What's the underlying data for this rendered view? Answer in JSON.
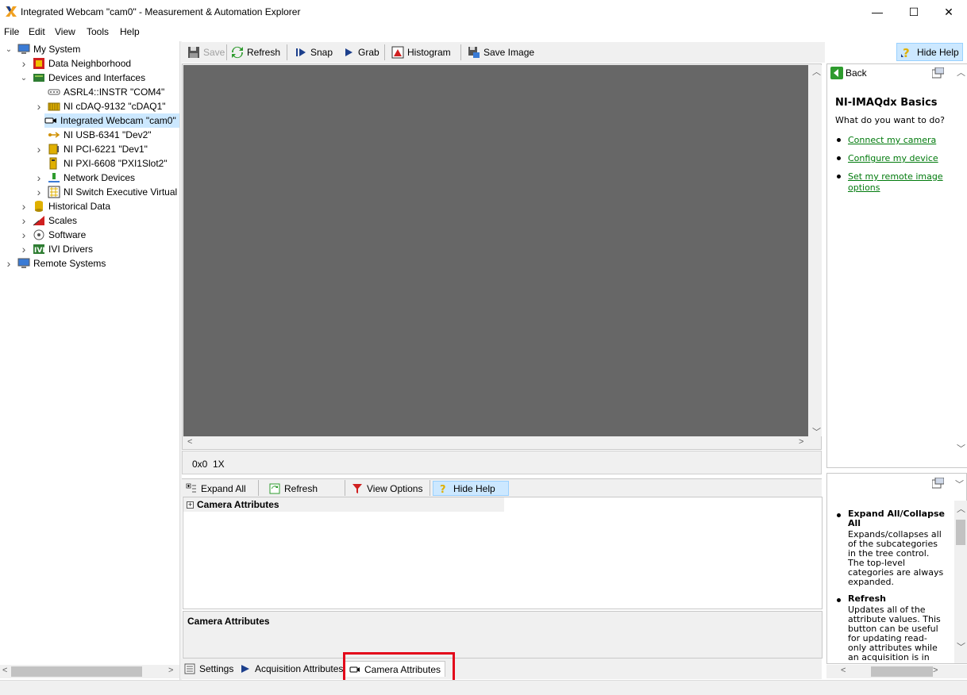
{
  "window": {
    "title": "Integrated Webcam  \"cam0\" - Measurement & Automation Explorer",
    "minimize": "—",
    "maximize": "☐",
    "close": "✕"
  },
  "menu": [
    "File",
    "Edit",
    "View",
    "Tools",
    "Help"
  ],
  "tree": [
    {
      "label": "My System",
      "level": 0,
      "expander": "open",
      "icon": "computer-icon"
    },
    {
      "label": "Data Neighborhood",
      "level": 1,
      "expander": "closed",
      "icon": "data-neighborhood-icon"
    },
    {
      "label": "Devices and Interfaces",
      "level": 1,
      "expander": "open",
      "icon": "devices-icon"
    },
    {
      "label": "ASRL4::INSTR \"COM4\"",
      "level": 2,
      "expander": "none",
      "icon": "serial-port-icon"
    },
    {
      "label": "NI cDAQ-9132 \"cDAQ1\"",
      "level": 2,
      "expander": "closed",
      "icon": "cdaq-icon"
    },
    {
      "label": "Integrated Webcam  \"cam0\"",
      "level": 2,
      "expander": "none",
      "icon": "webcam-icon",
      "selected": true
    },
    {
      "label": "NI USB-6341 \"Dev2\"",
      "level": 2,
      "expander": "none",
      "icon": "usb-icon"
    },
    {
      "label": "NI PCI-6221 \"Dev1\"",
      "level": 2,
      "expander": "closed",
      "icon": "pci-card-icon"
    },
    {
      "label": "NI PXI-6608 \"PXI1Slot2\"",
      "level": 2,
      "expander": "none",
      "icon": "pxi-module-icon"
    },
    {
      "label": "Network Devices",
      "level": 2,
      "expander": "closed",
      "icon": "network-icon"
    },
    {
      "label": "NI Switch Executive Virtual Devices",
      "level": 2,
      "expander": "closed",
      "icon": "switch-icon"
    },
    {
      "label": "Historical Data",
      "level": 1,
      "expander": "closed",
      "icon": "database-icon"
    },
    {
      "label": "Scales",
      "level": 1,
      "expander": "closed",
      "icon": "scales-icon"
    },
    {
      "label": "Software",
      "level": 1,
      "expander": "closed",
      "icon": "software-icon"
    },
    {
      "label": "IVI Drivers",
      "level": 1,
      "expander": "closed",
      "icon": "ivi-icon"
    },
    {
      "label": "Remote Systems",
      "level": 0,
      "expander": "closed",
      "icon": "remote-systems-icon"
    }
  ],
  "toolbar": {
    "save": "Save",
    "refresh": "Refresh",
    "snap": "Snap",
    "grab": "Grab",
    "histogram": "Histogram",
    "save_image": "Save Image",
    "hide_help": "Hide Help"
  },
  "viewer": {
    "coords": "0x0",
    "zoom": "1X"
  },
  "help": {
    "back": "Back",
    "heading": "NI-IMAQdx Basics",
    "question": "What do you want to do?",
    "links": [
      "Connect my camera",
      "Configure my device",
      "Set my remote image options"
    ],
    "expand_title": "Expand All/Collapse All",
    "expand_text": "Expands/collapses all of the subcategories in the tree control. The top-level categories are always expanded.",
    "refresh_title": "Refresh",
    "refresh_text": "Updates all of the attribute values. This button can be useful for updating read-only attributes while an acquisition is in"
  },
  "attributes": {
    "expand_all": "Expand All",
    "refresh": "Refresh",
    "view_options": "View Options",
    "hide_help": "Hide Help",
    "category": "Camera Attributes",
    "description_title": "Camera Attributes"
  },
  "tabs": {
    "settings": "Settings",
    "acquisition": "Acquisition Attributes",
    "camera": "Camera Attributes"
  },
  "colors": {
    "selection": "#cce8ff",
    "viewer_bg": "#676767",
    "link": "#007a0c",
    "highlight": "#e3061a"
  }
}
